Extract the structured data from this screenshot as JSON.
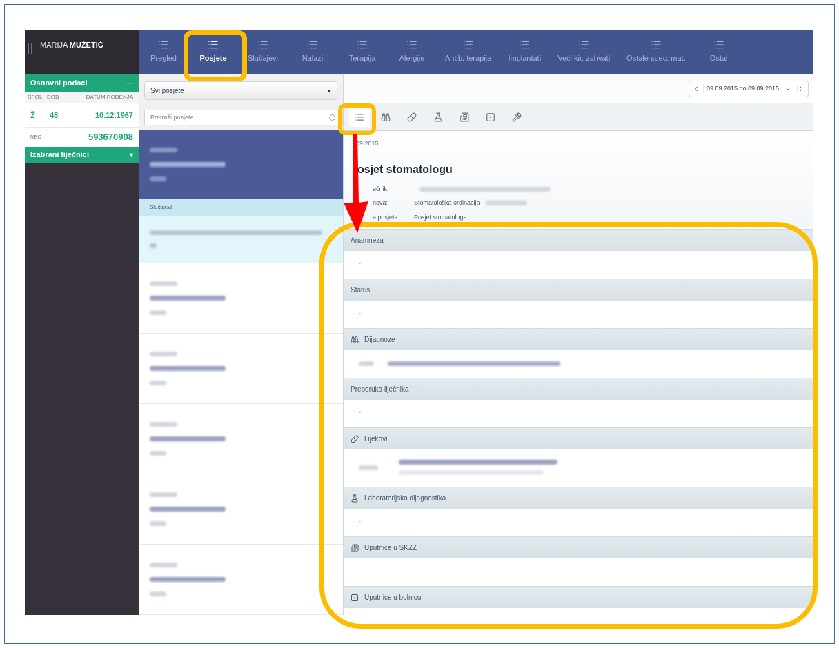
{
  "patient": {
    "first_name": "MARIJA",
    "last_name": "MUŽETIĆ"
  },
  "nav_tabs": [
    {
      "label": "Pregled",
      "selected": false
    },
    {
      "label": "Posjete",
      "selected": true
    },
    {
      "label": "Slučajevi",
      "selected": false
    },
    {
      "label": "Nalazi",
      "selected": false
    },
    {
      "label": "Terapija",
      "selected": false
    },
    {
      "label": "Alergije",
      "selected": false
    },
    {
      "label": "Antib. terapija",
      "selected": false
    },
    {
      "label": "Implantati",
      "selected": false
    },
    {
      "label": "Veći kir. zahvati",
      "selected": false
    },
    {
      "label": "Ostale spec. mat.",
      "selected": false
    },
    {
      "label": "Ostal",
      "selected": false
    }
  ],
  "sidebar": {
    "basic_title": "Osnovni podaci",
    "basic_toggle": "—",
    "columns": [
      "SPOL",
      "DOB",
      "DATUM ROĐENJA"
    ],
    "values": [
      "Ž",
      "48",
      "10.12.1967"
    ],
    "mbo_label": "MBO",
    "mbo_value": "593670908",
    "doctors_title": "Izabrani liječnici",
    "doctors_toggle": "▾"
  },
  "visits": {
    "filter": "Svi posjete",
    "search_placeholder": "Pretraži posjete",
    "cases_label": "Slučajevi",
    "items": [
      {
        "selected": true
      },
      {
        "selected": false
      },
      {
        "selected": false
      },
      {
        "selected": false
      },
      {
        "selected": false
      },
      {
        "selected": false
      }
    ]
  },
  "date_range": "09.09.2015 do 09.09.2015",
  "toolbar": [
    {
      "kind": "list",
      "selected": true
    },
    {
      "kind": "binoculars",
      "selected": false
    },
    {
      "kind": "pills",
      "selected": false
    },
    {
      "kind": "flask",
      "selected": false
    },
    {
      "kind": "form",
      "selected": false
    },
    {
      "kind": "square",
      "selected": false
    },
    {
      "kind": "wrench",
      "selected": false
    }
  ],
  "visit": {
    "date": "09.2015",
    "title": "osjet stomatologu",
    "fields": [
      {
        "label": "ečnik:"
      },
      {
        "label": "nova:",
        "value": "Stomatološka ordinacija"
      },
      {
        "label": "a posjeta:",
        "value": "Posjet stomatologa"
      }
    ]
  },
  "sections": [
    {
      "title": "Anamneza",
      "kind": "text",
      "content": "-"
    },
    {
      "title": "Status",
      "kind": "text",
      "content": "-"
    },
    {
      "title": "Dijagnoze",
      "kind": "binoculars"
    },
    {
      "title": "Preporuka liječnika",
      "kind": "text",
      "content": "-"
    },
    {
      "title": "Lijekovi",
      "kind": "pills"
    },
    {
      "title": "Laboratorijska dijagnostika",
      "kind": "flask",
      "content": "-"
    },
    {
      "title": "Uputnice u SKZZ",
      "kind": "form",
      "content": "-"
    },
    {
      "title": "Uputnice u bolnicu",
      "kind": "square"
    }
  ]
}
